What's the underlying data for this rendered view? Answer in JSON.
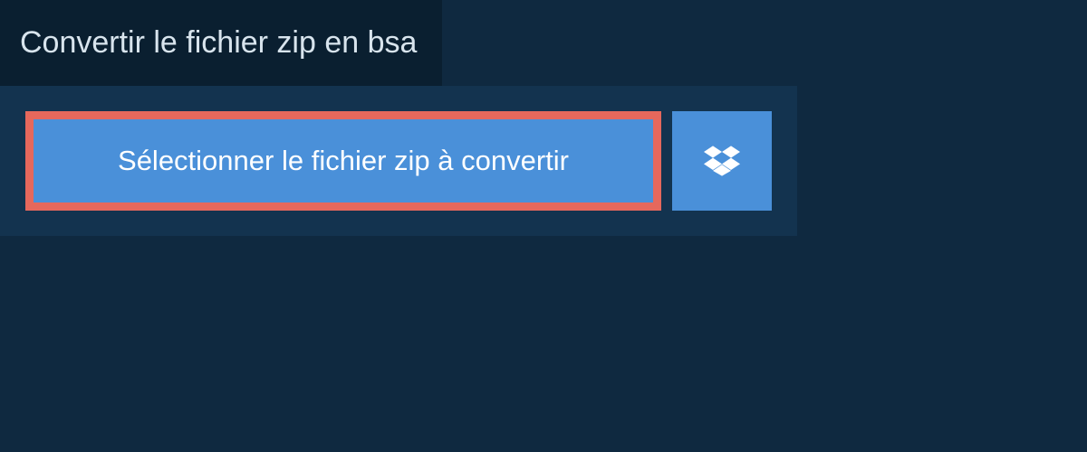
{
  "title": "Convertir le fichier zip en bsa",
  "buttons": {
    "select_file": "Sélectionner le fichier zip à convertir"
  },
  "colors": {
    "background": "#0f2940",
    "panel": "#13334f",
    "title_bg": "#0a1f30",
    "button_bg": "#4a90d9",
    "highlight_border": "#e6685c",
    "text_light": "#ffffff",
    "text_title": "#d8e4ed"
  }
}
